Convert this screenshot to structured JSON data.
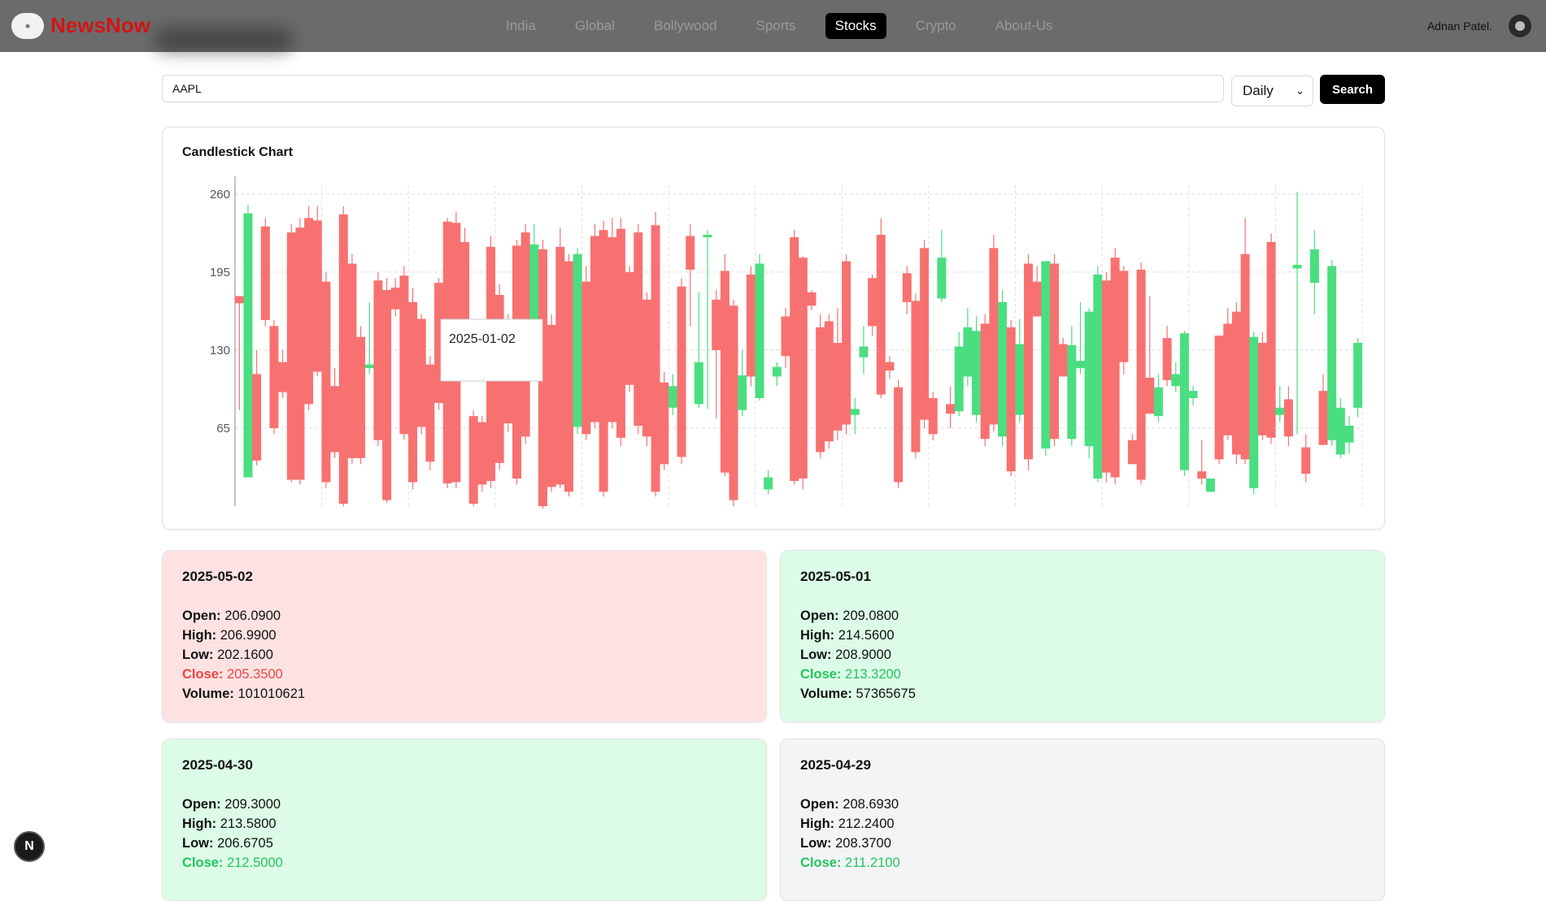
{
  "nav": {
    "brand": "NewsNow",
    "menu": [
      "India",
      "Global",
      "Bollywood",
      "Sports",
      "Stocks",
      "Crypto",
      "About-Us"
    ],
    "active_index": 4,
    "user": "Adnan Patel."
  },
  "search": {
    "value": "AAPL",
    "interval": "Daily",
    "button": "Search"
  },
  "chart_title": "Candlestick Chart",
  "chart_data": {
    "type": "candlestick",
    "yticks": [
      260,
      195,
      130,
      65
    ],
    "ylim": [
      0,
      268
    ],
    "tooltip": "2025-01-02",
    "candles": [
      [
        175,
        169,
        175,
        80
      ],
      [
        24,
        244,
        251,
        24
      ],
      [
        110,
        38,
        130,
        34
      ],
      [
        233,
        155,
        240,
        150
      ],
      [
        150,
        65,
        155,
        60
      ],
      [
        120,
        95,
        130,
        90
      ],
      [
        228,
        22,
        235,
        20
      ],
      [
        232,
        22,
        240,
        18
      ],
      [
        240,
        85,
        250,
        80
      ],
      [
        238,
        112,
        250,
        108
      ],
      [
        187,
        20,
        195,
        15
      ],
      [
        100,
        45,
        115,
        40
      ],
      [
        243,
        2,
        250,
        0
      ],
      [
        202,
        40,
        210,
        35
      ],
      [
        141,
        40,
        150,
        35
      ],
      [
        115,
        118,
        170,
        110
      ],
      [
        188,
        55,
        195,
        50
      ],
      [
        180,
        5,
        190,
        3
      ],
      [
        182,
        164,
        190,
        158
      ],
      [
        192,
        60,
        200,
        55
      ],
      [
        170,
        20,
        182,
        14
      ],
      [
        156,
        66,
        160,
        60
      ],
      [
        118,
        37,
        125,
        30
      ],
      [
        186,
        86,
        190,
        80
      ],
      [
        237,
        19,
        240,
        15
      ],
      [
        236,
        20,
        245,
        15
      ],
      [
        220,
        112,
        232,
        108
      ],
      [
        75,
        2,
        80,
        0
      ],
      [
        70,
        18,
        75,
        12
      ],
      [
        216,
        21,
        225,
        15
      ],
      [
        176,
        36,
        185,
        30
      ],
      [
        156,
        69,
        160,
        62
      ],
      [
        217,
        23,
        222,
        18
      ],
      [
        228,
        58,
        235,
        52
      ],
      [
        130,
        218,
        235,
        115
      ],
      [
        214,
        0,
        222,
        -2
      ],
      [
        151,
        16,
        160,
        12
      ],
      [
        216,
        18,
        232,
        15
      ],
      [
        204,
        12,
        210,
        8
      ],
      [
        66,
        210,
        215,
        60
      ],
      [
        187,
        60,
        200,
        55
      ],
      [
        225,
        70,
        235,
        65
      ],
      [
        230,
        12,
        238,
        8
      ],
      [
        224,
        70,
        240,
        65
      ],
      [
        231,
        57,
        240,
        50
      ],
      [
        195,
        101,
        200,
        95
      ],
      [
        228,
        67,
        235,
        60
      ],
      [
        172,
        58,
        178,
        50
      ],
      [
        234,
        12,
        245,
        8
      ],
      [
        103,
        35,
        112,
        30
      ],
      [
        82,
        100,
        110,
        76
      ],
      [
        183,
        41,
        190,
        35
      ],
      [
        225,
        197,
        235,
        150
      ],
      [
        85,
        120,
        178,
        82
      ],
      [
        226,
        226,
        230,
        81
      ],
      [
        172,
        130,
        180,
        73
      ],
      [
        196,
        28,
        210,
        25
      ],
      [
        167,
        5,
        172,
        0
      ],
      [
        80,
        109,
        130,
        75
      ],
      [
        193,
        108,
        200,
        100
      ],
      [
        90,
        202,
        210,
        88
      ],
      [
        14,
        24,
        30,
        10
      ],
      [
        108,
        116,
        120,
        100
      ],
      [
        158,
        125,
        165,
        115
      ],
      [
        224,
        21,
        230,
        18
      ],
      [
        207,
        23,
        208,
        14
      ],
      [
        178,
        167,
        180,
        163
      ],
      [
        149,
        45,
        160,
        40
      ],
      [
        154,
        54,
        160,
        48
      ],
      [
        136,
        63,
        165,
        55
      ],
      [
        204,
        68,
        210,
        60
      ],
      [
        76,
        81,
        90,
        60
      ],
      [
        124,
        133,
        150,
        110
      ],
      [
        190,
        150,
        193,
        142
      ],
      [
        226,
        93,
        240,
        90
      ],
      [
        120,
        113,
        125,
        106
      ],
      [
        99,
        20,
        105,
        15
      ],
      [
        194,
        170,
        200,
        160
      ],
      [
        171,
        45,
        177,
        40
      ],
      [
        215,
        72,
        222,
        65
      ],
      [
        90,
        60,
        95,
        55
      ],
      [
        173,
        207,
        230,
        170
      ],
      [
        85,
        77,
        100,
        65
      ],
      [
        79,
        133,
        145,
        75
      ],
      [
        108,
        149,
        165,
        100
      ],
      [
        76,
        146,
        158,
        70
      ],
      [
        152,
        56,
        160,
        50
      ],
      [
        215,
        68,
        226,
        62
      ],
      [
        58,
        170,
        180,
        50
      ],
      [
        149,
        29,
        155,
        25
      ],
      [
        76,
        135,
        156,
        70
      ],
      [
        202,
        39,
        210,
        30
      ],
      [
        187,
        158,
        200,
        180
      ],
      [
        48,
        204,
        200,
        42
      ],
      [
        202,
        56,
        210,
        50
      ],
      [
        135,
        108,
        140,
        130
      ],
      [
        56,
        134,
        150,
        50
      ],
      [
        115,
        121,
        170,
        110
      ],
      [
        50,
        162,
        165,
        40
      ],
      [
        23,
        193,
        200,
        20
      ],
      [
        188,
        28,
        195,
        20
      ],
      [
        207,
        24,
        215,
        18
      ],
      [
        196,
        120,
        200,
        110
      ],
      [
        55,
        35,
        60,
        90
      ],
      [
        197,
        22,
        203,
        18
      ],
      [
        107,
        77,
        175,
        84
      ],
      [
        75,
        99,
        110,
        70
      ],
      [
        140,
        105,
        150,
        100
      ],
      [
        100,
        110,
        120,
        95
      ],
      [
        30,
        144,
        146,
        25
      ],
      [
        90,
        96,
        100,
        84
      ],
      [
        29,
        23,
        55,
        18
      ],
      [
        12,
        23,
        14,
        22
      ],
      [
        142,
        39,
        140,
        35
      ],
      [
        152,
        59,
        165,
        55
      ],
      [
        162,
        43,
        170,
        35
      ],
      [
        210,
        39,
        240,
        35
      ],
      [
        15,
        141,
        145,
        10
      ],
      [
        136,
        59,
        145,
        55
      ],
      [
        220,
        57,
        227,
        52
      ],
      [
        76,
        82,
        100,
        70
      ],
      [
        89,
        58,
        100,
        50
      ],
      [
        198,
        201,
        262,
        60
      ],
      [
        49,
        27,
        60,
        20
      ],
      [
        186,
        214,
        230,
        160
      ],
      [
        96,
        51,
        110,
        90
      ],
      [
        55,
        200,
        205,
        50
      ],
      [
        43,
        82,
        90,
        40
      ],
      [
        53,
        67,
        75,
        44
      ],
      [
        82,
        136,
        140,
        74
      ]
    ]
  },
  "cards": [
    {
      "date": "2025-05-02",
      "open": "206.0900",
      "high": "206.9900",
      "low": "202.1600",
      "close": "205.3500",
      "volume": "101010621",
      "tone": "red"
    },
    {
      "date": "2025-05-01",
      "open": "209.0800",
      "high": "214.5600",
      "low": "208.9000",
      "close": "213.3200",
      "volume": "57365675",
      "tone": "green"
    },
    {
      "date": "2025-04-30",
      "open": "209.3000",
      "high": "213.5800",
      "low": "206.6705",
      "close": "212.5000",
      "tone": "green"
    },
    {
      "date": "2025-04-29",
      "open": "208.6930",
      "high": "212.2400",
      "low": "208.3700",
      "close": "211.2100",
      "tone": "gray"
    }
  ],
  "labels": {
    "open": "Open:",
    "high": "High:",
    "low": "Low:",
    "close": "Close:",
    "volume": "Volume:"
  },
  "dev_badge": "N",
  "colors": {
    "up": "#4ade80",
    "down": "#f87171",
    "nav_bg": "#6b6b6b",
    "brand": "#d41414"
  }
}
